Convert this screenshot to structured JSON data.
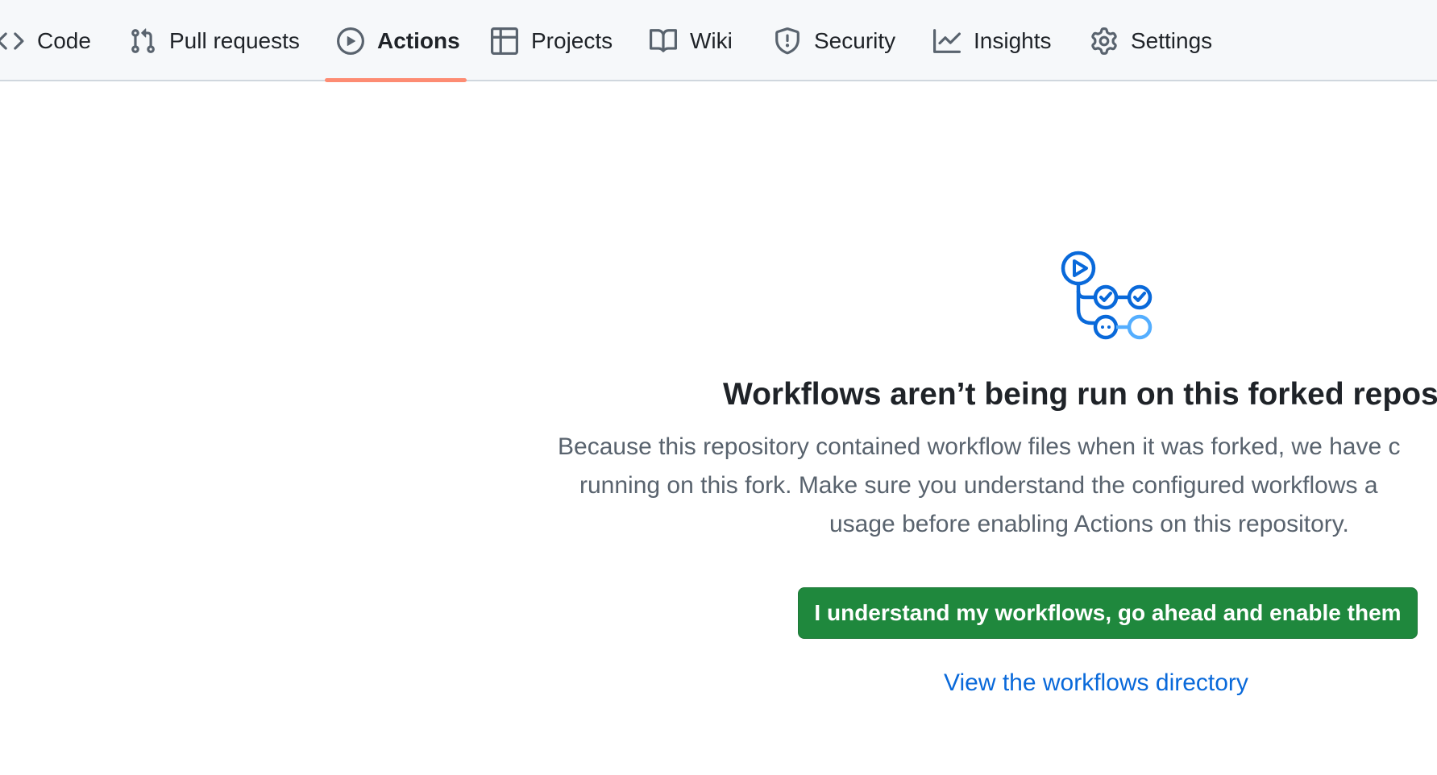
{
  "nav": {
    "tabs": [
      {
        "label": "Code",
        "icon": "code-icon",
        "active": false
      },
      {
        "label": "Pull requests",
        "icon": "git-pull-request-icon",
        "active": false
      },
      {
        "label": "Actions",
        "icon": "play-icon",
        "active": true
      },
      {
        "label": "Projects",
        "icon": "table-icon",
        "active": false
      },
      {
        "label": "Wiki",
        "icon": "book-icon",
        "active": false
      },
      {
        "label": "Security",
        "icon": "shield-icon",
        "active": false
      },
      {
        "label": "Insights",
        "icon": "graph-icon",
        "active": false
      },
      {
        "label": "Settings",
        "icon": "gear-icon",
        "active": false
      }
    ],
    "active_underline_color": "#fd8c73"
  },
  "hero": {
    "icon": "workflow-icon",
    "title": "Workflows aren’t being run on this forked reposit",
    "description_lines": [
      "Because this repository contained workflow files when it was forked, we have c",
      "running on this fork. Make sure you understand the configured workflows a",
      "usage before enabling Actions on this repository."
    ],
    "enable_button_label": "I understand my workflows, go ahead and enable them",
    "view_link_label": "View the workflows directory"
  },
  "colors": {
    "primary_button": "#1f883d",
    "link": "#0969da",
    "icon_blue": "#0969da",
    "icon_light_blue": "#54aeff"
  }
}
